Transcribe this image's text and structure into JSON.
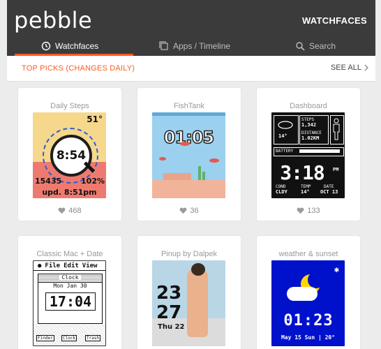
{
  "header": {
    "logo": "pebble",
    "title": "WATCHFACES",
    "tabs": [
      {
        "label": "Watchfaces",
        "icon": "clock-icon",
        "active": true
      },
      {
        "label": "Apps / Timeline",
        "icon": "apps-icon",
        "active": false
      },
      {
        "label": "Search",
        "icon": "search-icon",
        "active": false
      }
    ],
    "accent_color": "#ff5a1f"
  },
  "picks": {
    "title": "TOP PICKS (CHANGES DAILY)",
    "see_all": "SEE ALL"
  },
  "cards": [
    {
      "title": "Daily Steps",
      "likes": "468",
      "face": {
        "time": "8:54",
        "temp": "51°",
        "steps": "15435",
        "battery": "102%",
        "updated": "upd. 8:51pm"
      }
    },
    {
      "title": "FishTank",
      "likes": "36",
      "face": {
        "time": "01:05"
      }
    },
    {
      "title": "Dashboard",
      "likes": "133",
      "face": {
        "temp": "14°",
        "steps_label": "STEPS",
        "steps": "1,342",
        "distance_label": "DISTANCE",
        "distance": "1.02KM",
        "battery_label": "BATTERY",
        "time": "3:18",
        "ampm": "PM",
        "cond_label": "COND",
        "cond": "CLDY",
        "temp_label": "TEMP",
        "temp2": "14°",
        "date_label": "DATE",
        "date": "OCT 13"
      }
    },
    {
      "title": "Classic Mac + Date",
      "likes": "",
      "face": {
        "menu_file": "File",
        "menu_edit": "Edit",
        "menu_view": "View",
        "window_title": "Clock",
        "date": "Mon Jan 30",
        "time": "17:04",
        "icon1": "Finder",
        "icon2": "Clock",
        "icon3": "Trash"
      }
    },
    {
      "title": "Pinup by Dalpek",
      "likes": "",
      "face": {
        "hour": "23",
        "minute": "27",
        "date": "Thu 22"
      }
    },
    {
      "title": "weather & sunset",
      "likes": "",
      "face": {
        "time": "01:23",
        "date": "May 15 Sun | 20°"
      }
    }
  ]
}
